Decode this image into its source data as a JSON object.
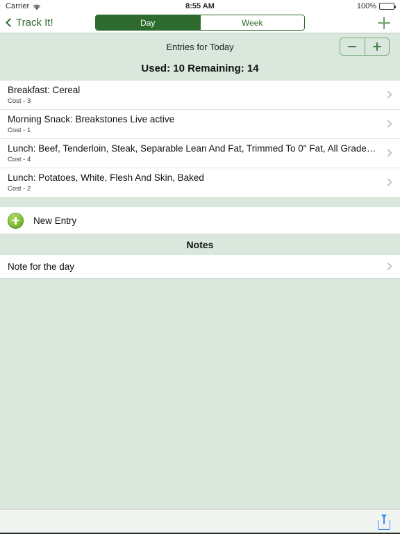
{
  "status_bar": {
    "carrier": "Carrier",
    "wifi_icon": "wifi-icon",
    "time": "8:55 AM",
    "battery_percent": "100%",
    "battery_icon": "battery-full-icon"
  },
  "nav_bar": {
    "back_label": "Track It!",
    "back_icon": "chevron-left-icon",
    "add_icon": "plus-icon",
    "segments": [
      {
        "label": "Day",
        "selected": true
      },
      {
        "label": "Week",
        "selected": false
      }
    ]
  },
  "summary": {
    "title": "Entries for Today",
    "counts": "Used: 10 Remaining: 14",
    "stepper": {
      "minus_label": "−",
      "minus_icon": "minus-icon",
      "plus_label": "+",
      "plus_icon": "plus-icon"
    }
  },
  "entries": [
    {
      "title": "Breakfast: Cereal",
      "cost": "Cost - 3",
      "chevron_icon": "chevron-right-icon"
    },
    {
      "title": "Morning Snack: Breakstones Live active",
      "cost": "Cost - 1",
      "chevron_icon": "chevron-right-icon"
    },
    {
      "title": "Lunch: Beef, Tenderloin, Steak, Separable Lean And Fat, Trimmed To 0\" Fat, All Grades, Coo...",
      "cost": "Cost - 4",
      "chevron_icon": "chevron-right-icon"
    },
    {
      "title": "Lunch: Potatoes, White, Flesh And Skin, Baked",
      "cost": "Cost - 2",
      "chevron_icon": "chevron-right-icon"
    }
  ],
  "new_entry": {
    "label": "New Entry",
    "icon": "plus-circle-icon"
  },
  "notes_section": {
    "header": "Notes",
    "items": [
      {
        "title": "Note for the day",
        "chevron_icon": "chevron-right-icon"
      }
    ]
  },
  "toolbar": {
    "share_icon": "share-icon"
  },
  "colors": {
    "accent_green": "#2d6a2d",
    "background_mint": "#d9e7dc",
    "row_white": "#ffffff",
    "stepper_border": "#77a87a",
    "share_blue": "#3b8cf5",
    "new_entry_green": "#8cc63f"
  }
}
